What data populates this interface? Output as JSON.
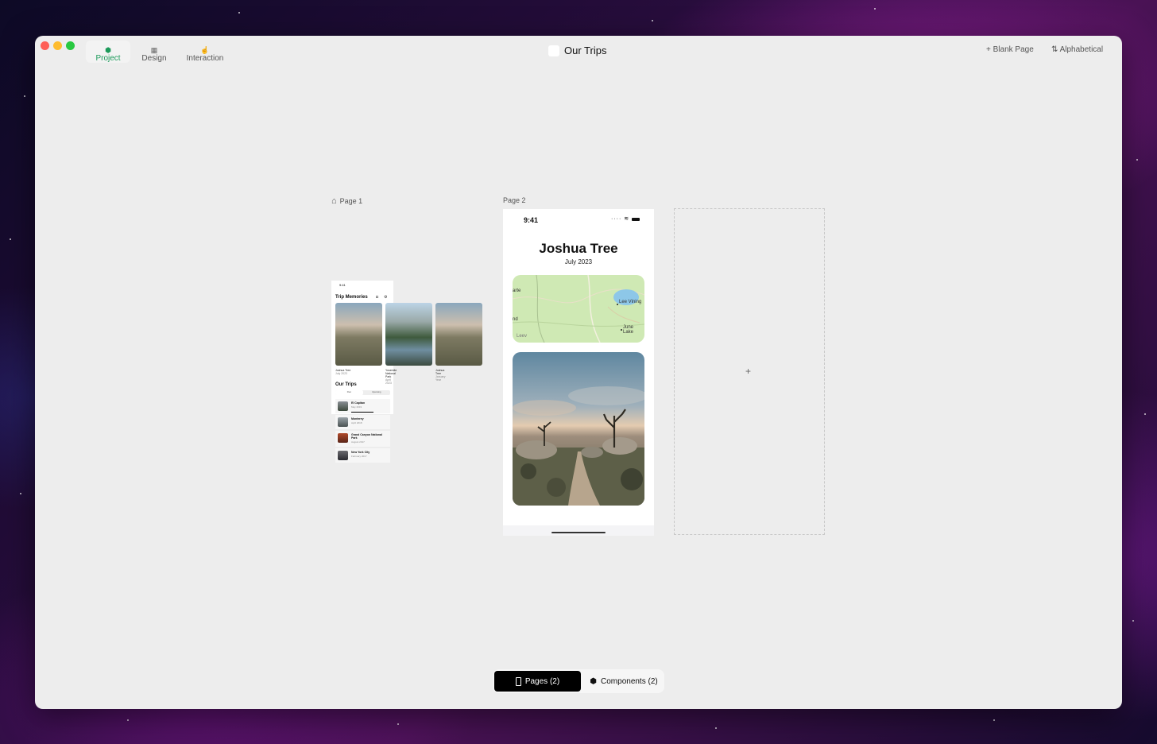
{
  "window": {
    "title": "Our Trips",
    "toolbar_tabs": [
      {
        "label": "Project",
        "icon": "project-icon",
        "active": true
      },
      {
        "label": "Design",
        "icon": "design-icon",
        "active": false
      },
      {
        "label": "Interaction",
        "icon": "interaction-icon",
        "active": false
      }
    ],
    "actions": {
      "blank_page": "+ Blank Page",
      "alphabetical": "⇅ Alphabetical"
    },
    "accent_color": "#1c9a5a"
  },
  "canvas": {
    "page1": {
      "label": "Page 1",
      "time": "9:41",
      "heading": "Trip Memories",
      "cards": [
        {
          "title": "Joshua Tree",
          "subtitle": "July 2023"
        },
        {
          "title": "Yosemite National Park",
          "subtitle": "April 2023"
        },
        {
          "title": "Joshua Tree",
          "subtitle": "January Year"
        }
      ],
      "section_title": "Our Trips",
      "segments": [
        "Past",
        "Upcoming"
      ],
      "trips": [
        {
          "title": "El Capitan",
          "subtitle": "May 2019"
        },
        {
          "title": "Monterey",
          "subtitle": "April 2018"
        },
        {
          "title": "Grand Canyon National Park",
          "subtitle": "August 2017"
        },
        {
          "title": "New York City",
          "subtitle": "February 2017"
        }
      ]
    },
    "page2": {
      "label": "Page 2",
      "time": "9:41",
      "status_icons": "····  ≋",
      "title": "Joshua Tree",
      "date": "July 2023",
      "map_labels": {
        "left_top": "arte",
        "left_mid": "nd",
        "lee_vining": "Lee Vining",
        "june_lake": "June Lake",
        "bottom": "Leev"
      }
    },
    "new_page_plus": "+"
  },
  "bottom_bar": {
    "pages": "Pages (2)",
    "components": "Components (2)"
  }
}
